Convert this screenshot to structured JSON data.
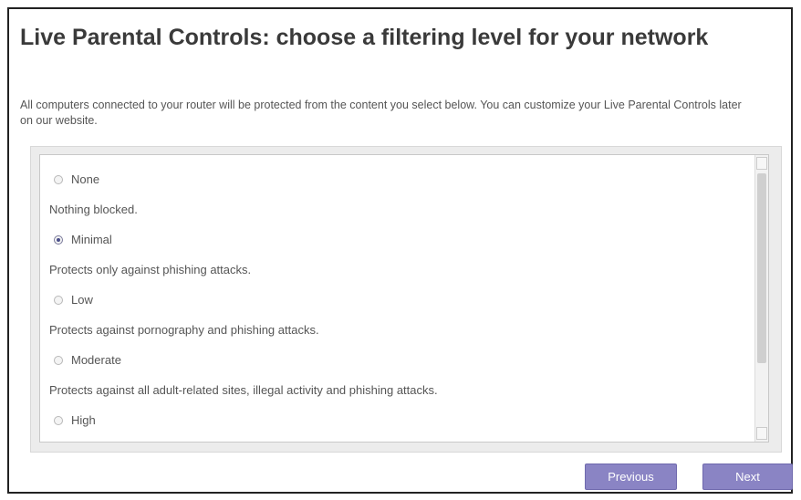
{
  "page": {
    "title": "Live Parental Controls: choose a filtering level for your network",
    "description": "All computers connected to your router will be protected from the content you select below. You can customize your Live Parental Controls later on our website."
  },
  "options": [
    {
      "label": "None",
      "description": "Nothing blocked.",
      "checked": false
    },
    {
      "label": "Minimal",
      "description": "Protects only against phishing attacks.",
      "checked": true
    },
    {
      "label": "Low",
      "description": "Protects against pornography and phishing attacks.",
      "checked": false
    },
    {
      "label": "Moderate",
      "description": "Protects against all adult-related sites, illegal activity and phishing attacks.",
      "checked": false
    },
    {
      "label": "High",
      "description": "",
      "checked": false
    }
  ],
  "buttons": {
    "previous": "Previous",
    "next": "Next"
  },
  "colors": {
    "button": "#8a84c4",
    "text": "#555555"
  }
}
